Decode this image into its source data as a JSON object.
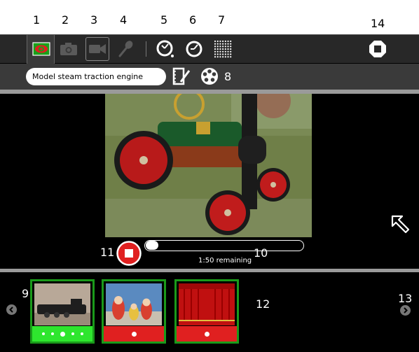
{
  "callouts": [
    "1",
    "2",
    "3",
    "4",
    "5",
    "6",
    "7",
    "8",
    "9",
    "10",
    "11",
    "12",
    "13",
    "14"
  ],
  "title_field": {
    "value": "Model steam traction engine"
  },
  "player": {
    "remaining": "1:50 remaining",
    "progress": 0.0
  },
  "icons": {
    "activity": "eye-icon",
    "camera": "camera-icon",
    "video": "video-camera-icon",
    "audio": "microphone-icon",
    "timer": "timer-dial-icon",
    "duration": "duration-dial-icon",
    "quality": "grid-quality-icon",
    "stop_activity": "stop-icon",
    "notes": "notes-edit-icon",
    "share": "share-people-icon",
    "fullscreen": "fullscreen-arrow-icon",
    "record_stop": "record-stop-icon",
    "tray_left": "chevron-left-icon",
    "tray_right": "chevron-right-icon"
  },
  "tray": {
    "items": [
      {
        "kind": "photo-locomotive",
        "selected": true,
        "dots": 5,
        "active_dot": 2,
        "bar_color": "#2ee62e"
      },
      {
        "kind": "photo-dolls",
        "selected": false,
        "dots": 1,
        "active_dot": 0,
        "bar_color": "#e02020"
      },
      {
        "kind": "photo-curtain",
        "selected": false,
        "dots": 1,
        "active_dot": 0,
        "bar_color": "#e02020"
      }
    ]
  },
  "colors": {
    "accent_green": "#1a9a1a",
    "record_red": "#e02020"
  }
}
